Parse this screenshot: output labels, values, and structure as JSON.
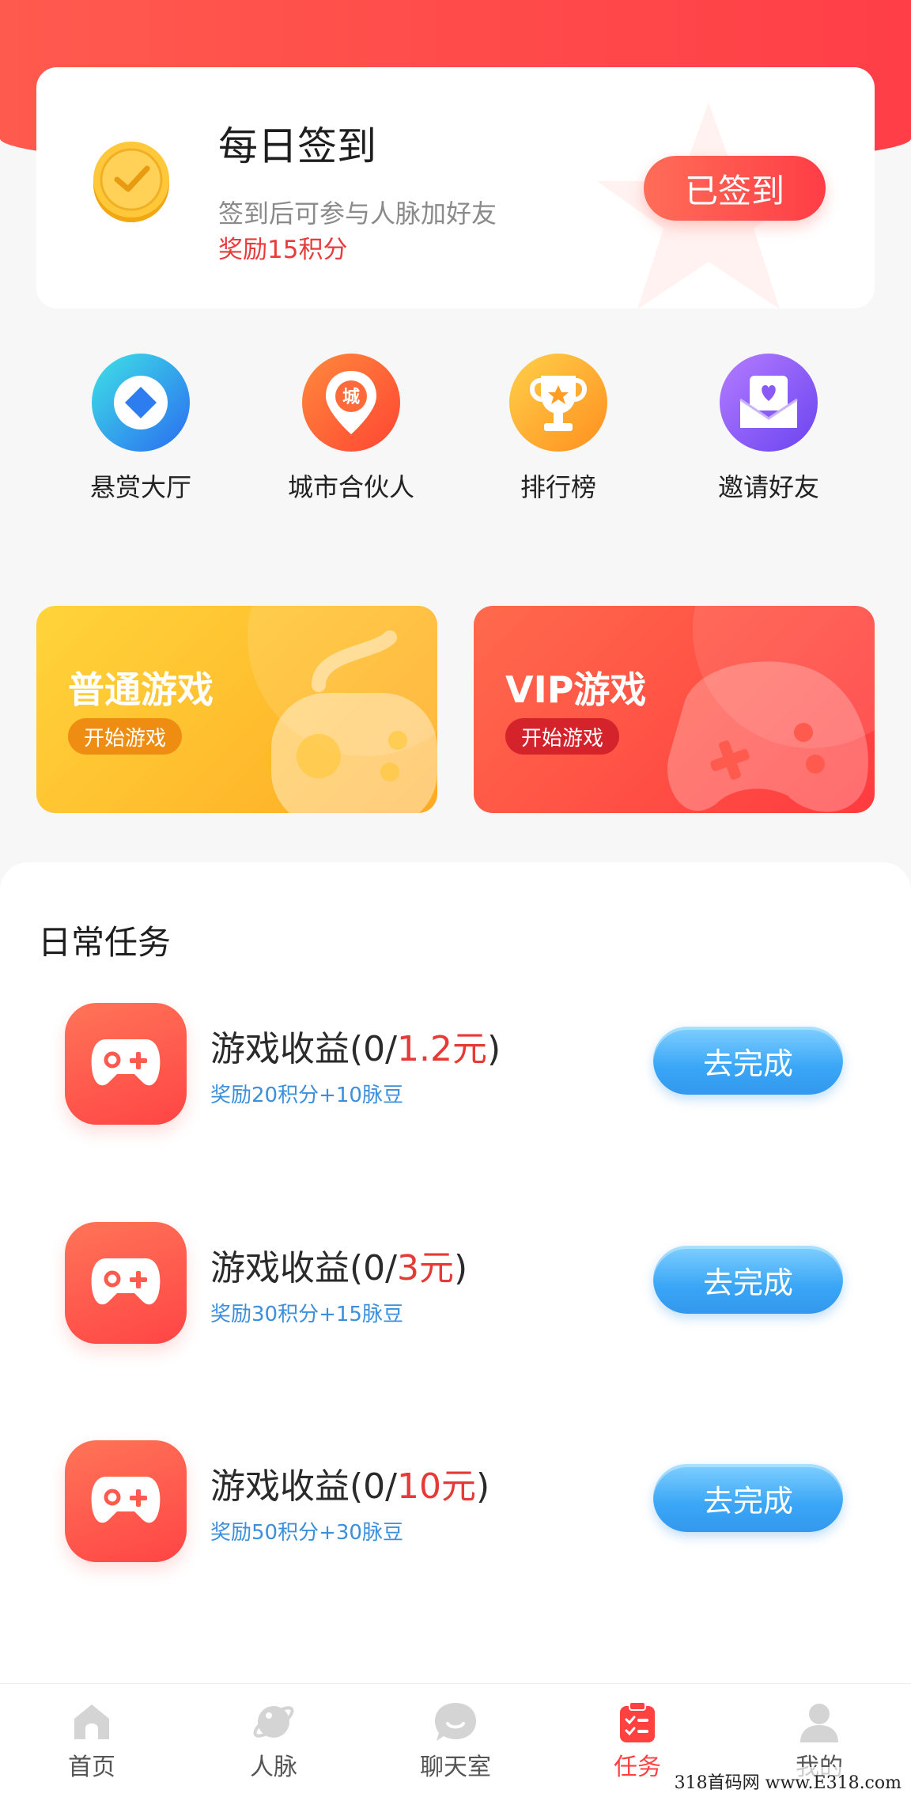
{
  "checkin": {
    "title": "每日签到",
    "desc": "签到后可参与人脉加好友",
    "reward": "奖励15积分",
    "button": "已签到"
  },
  "quick_nav": [
    {
      "label": "悬赏大厅",
      "icon": "diamond-coin-icon"
    },
    {
      "label": "城市合伙人",
      "icon": "city-pin-icon"
    },
    {
      "label": "排行榜",
      "icon": "trophy-icon"
    },
    {
      "label": "邀请好友",
      "icon": "heart-mail-icon"
    }
  ],
  "games": {
    "normal": {
      "title": "普通游戏",
      "button": "开始游戏"
    },
    "vip": {
      "title": "VIP游戏",
      "button": "开始游戏"
    }
  },
  "tasks": {
    "title": "日常任务",
    "items": [
      {
        "name_prefix": "游戏收益(0/",
        "amount": "1.2元",
        "name_suffix": ")",
        "reward": "奖励20积分+10脉豆",
        "button": "去完成"
      },
      {
        "name_prefix": "游戏收益(0/",
        "amount": "3元",
        "name_suffix": ")",
        "reward": "奖励30积分+15脉豆",
        "button": "去完成"
      },
      {
        "name_prefix": "游戏收益(0/",
        "amount": "10元",
        "name_suffix": ")",
        "reward": "奖励50积分+30脉豆",
        "button": "去完成"
      }
    ]
  },
  "tabbar": [
    {
      "label": "首页",
      "icon": "home-icon",
      "active": false
    },
    {
      "label": "人脉",
      "icon": "planet-icon",
      "active": false
    },
    {
      "label": "聊天室",
      "icon": "chat-icon",
      "active": false
    },
    {
      "label": "任务",
      "icon": "task-clipboard-icon",
      "active": true
    },
    {
      "label": "我的",
      "icon": "profile-icon",
      "active": false
    }
  ],
  "watermark": "318首码网 www.E318.com",
  "colors": {
    "accent_red": "#ff4140",
    "reward_blue": "#3b8fdc",
    "normal_game_yellow": "#ffc02e",
    "task_button_blue": "#3aa6f6"
  }
}
